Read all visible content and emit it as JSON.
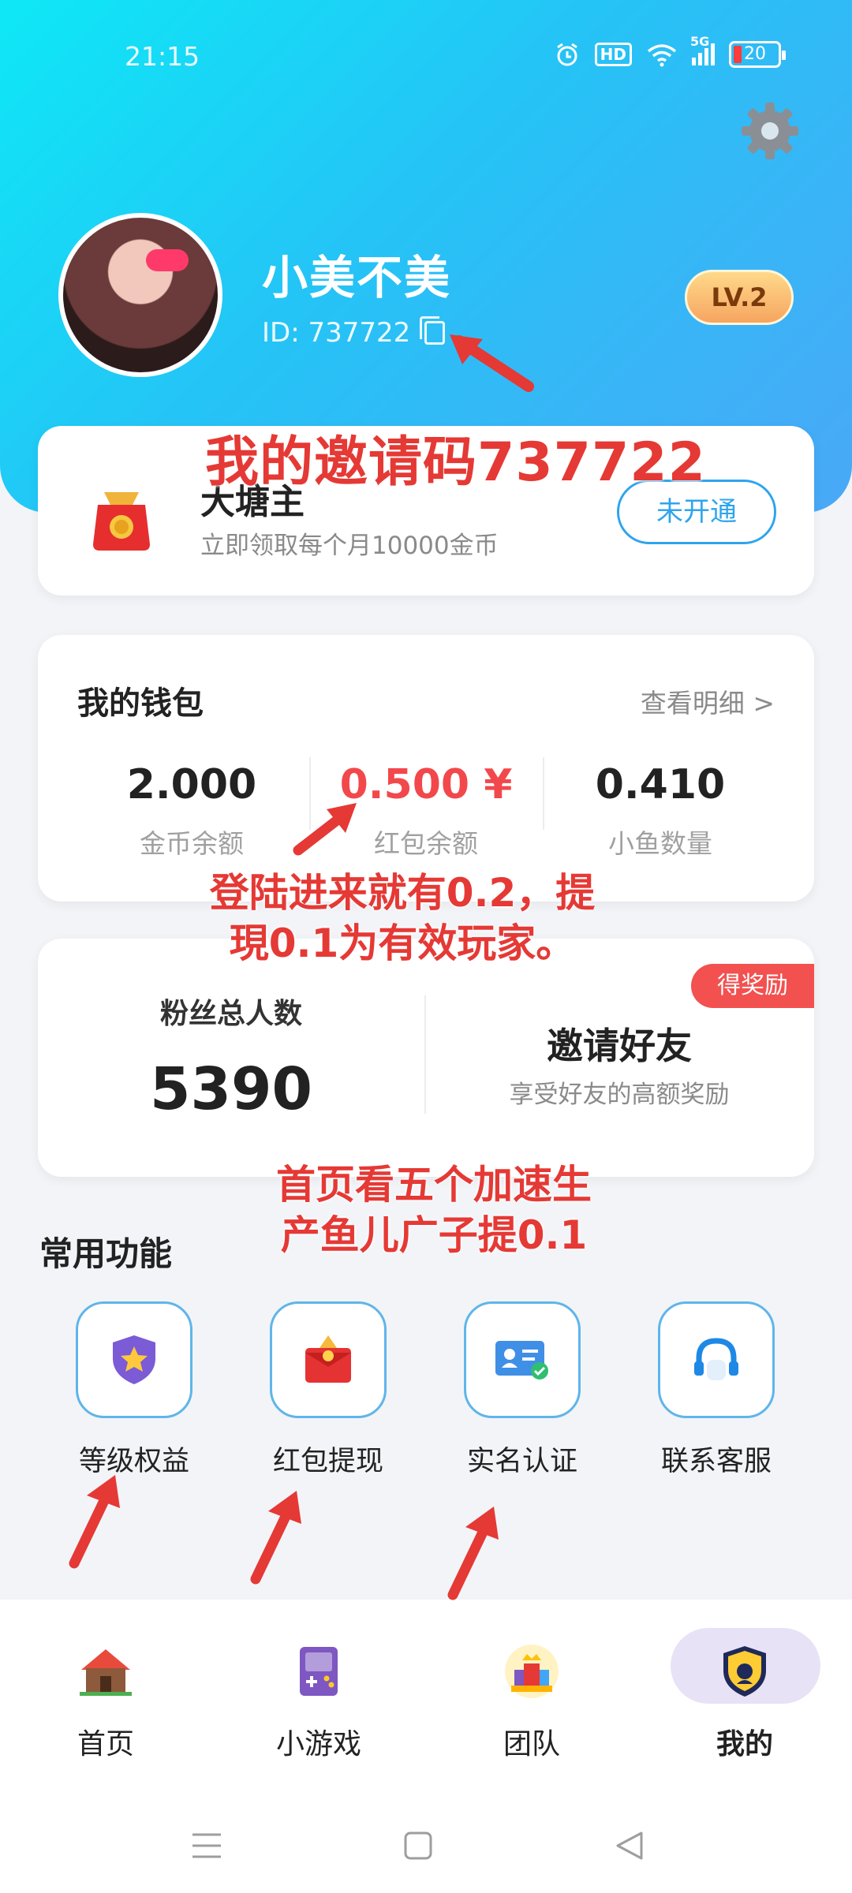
{
  "status_bar": {
    "time": "21:15",
    "network": "5G",
    "hd": "HD",
    "battery": "20"
  },
  "profile": {
    "username": "小美不美",
    "user_id": "ID: 737722",
    "level": "LV.2"
  },
  "vip": {
    "title": "大塘主",
    "subtitle": "立即领取每个月10000金币",
    "button": "未开通"
  },
  "wallet": {
    "title": "我的钱包",
    "detail_link": "查看明细 >",
    "items": [
      {
        "value": "2.000",
        "label": "金币余额"
      },
      {
        "value": "0.500 ¥",
        "label": "红包余额"
      },
      {
        "value": "0.410",
        "label": "小鱼数量"
      }
    ]
  },
  "fans": {
    "label": "粉丝总人数",
    "count": "5390",
    "invite_title": "邀请好友",
    "invite_subtitle": "享受好友的高额奖励",
    "reward_badge": "得奖励"
  },
  "functions": {
    "title": "常用功能",
    "items": [
      {
        "label": "等级权益",
        "icon": "shield-star-icon"
      },
      {
        "label": "红包提现",
        "icon": "red-envelope-icon"
      },
      {
        "label": "实名认证",
        "icon": "id-card-icon"
      },
      {
        "label": "联系客服",
        "icon": "headset-icon"
      }
    ]
  },
  "nav": {
    "items": [
      {
        "label": "首页",
        "icon": "home-icon"
      },
      {
        "label": "小游戏",
        "icon": "gamepad-icon"
      },
      {
        "label": "团队",
        "icon": "team-icon"
      },
      {
        "label": "我的",
        "icon": "profile-badge-icon",
        "active": true
      }
    ]
  },
  "annotations": {
    "invite_code": "我的邀请码737722",
    "login_note_1": "登陆进来就有0.2，提",
    "login_note_2": "現0.1为有效玩家。",
    "home_note_1": "首页看五个加速生",
    "home_note_2": "产鱼儿广子提0.1"
  },
  "colors": {
    "header_gradient_start": "#0ee8f6",
    "header_gradient_end": "#4aa8f7",
    "accent_blue": "#2fa4ee",
    "red": "#f2484b",
    "annotation_red": "#e53935"
  }
}
